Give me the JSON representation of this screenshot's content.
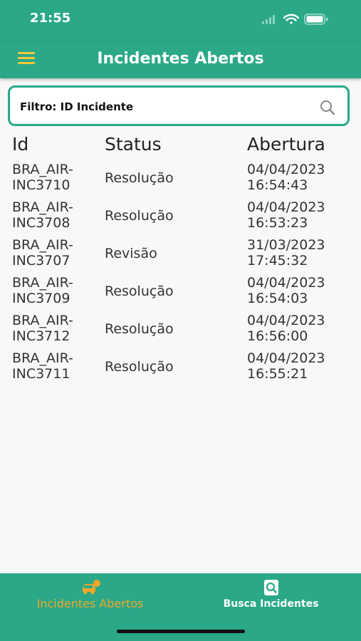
{
  "status_bar": {
    "time": "21:55"
  },
  "header": {
    "title": "Incidentes Abertos"
  },
  "filter": {
    "placeholder": "Filtro: ID Incidente",
    "value": ""
  },
  "table": {
    "columns": [
      "Id",
      "Status",
      "Abertura"
    ],
    "rows": [
      {
        "id_line1": "BRA_AIR-",
        "id_line2": "INC3710",
        "status": "Resolução",
        "date": "04/04/2023",
        "time": "16:54:43"
      },
      {
        "id_line1": "BRA_AIR-",
        "id_line2": "INC3708",
        "status": "Resolução",
        "date": "04/04/2023",
        "time": "16:53:23"
      },
      {
        "id_line1": "BRA_AIR-",
        "id_line2": "INC3707",
        "status": "Revisão",
        "date": "31/03/2023",
        "time": "17:45:32"
      },
      {
        "id_line1": "BRA_AIR-",
        "id_line2": "INC3709",
        "status": "Resolução",
        "date": "04/04/2023",
        "time": "16:54:03"
      },
      {
        "id_line1": "BRA_AIR-",
        "id_line2": "INC3712",
        "status": "Resolução",
        "date": "04/04/2023",
        "time": "16:56:00"
      },
      {
        "id_line1": "BRA_AIR-",
        "id_line2": "INC3711",
        "status": "Resolução",
        "date": "04/04/2023",
        "time": "16:55:21"
      }
    ]
  },
  "tabs": [
    {
      "label": "Incidentes Abertos",
      "icon": "car-incident-icon",
      "active": true
    },
    {
      "label": "Busca Incidentes",
      "icon": "search-document-icon",
      "active": false
    }
  ],
  "colors": {
    "primary": "#2aa888",
    "accent": "#f4a62a",
    "menu_icon": "#f4c73a"
  }
}
